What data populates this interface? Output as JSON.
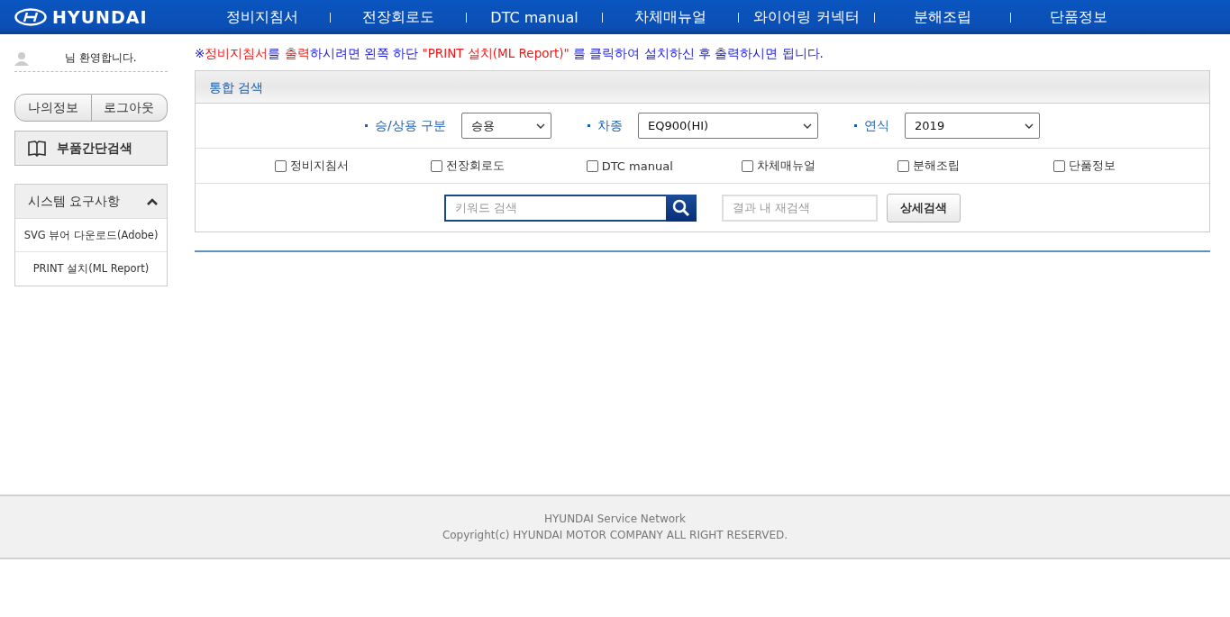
{
  "header": {
    "logo": "HYUNDAI",
    "nav": [
      "정비지침서",
      "전장회로도",
      "DTC manual",
      "차체매뉴얼",
      "와이어링 커넥터",
      "분해조립",
      "단품정보"
    ]
  },
  "sidebar": {
    "welcome": "님 환영합니다.",
    "buttons": [
      "나의정보",
      "로그아웃"
    ],
    "parts_search": "부품간단검색",
    "requirements": {
      "title": "시스템 요구사항",
      "expanded": true,
      "items": [
        "SVG 뷰어 다운로드(Adobe)",
        "PRINT 설치(ML Report)"
      ]
    }
  },
  "notice": [
    {
      "text": "※",
      "highlight": false
    },
    {
      "text": "정비지침서",
      "highlight": true
    },
    {
      "text": "를 ",
      "highlight": false
    },
    {
      "text": "출력",
      "highlight": true
    },
    {
      "text": "하시려면 왼쪽 하단 ",
      "highlight": false
    },
    {
      "text": "\"PRINT 설치(ML Report)\"",
      "highlight": true
    },
    {
      "text": " 를 클릭하여 설치하신 후 출력하시면 됩니다.",
      "highlight": false
    }
  ],
  "search_panel": {
    "title": "통합 검색",
    "filters": [
      {
        "label": "승/상용 구분",
        "value": "승용"
      },
      {
        "label": "차종",
        "value": "EQ900(HI)"
      },
      {
        "label": "연식",
        "value": "2019"
      }
    ],
    "checkboxes": [
      {
        "label": "정비지침서",
        "checked": false
      },
      {
        "label": "전장회로도",
        "checked": false
      },
      {
        "label": "DTC manual",
        "checked": false
      },
      {
        "label": "차체매뉴얼",
        "checked": false
      },
      {
        "label": "분해조립",
        "checked": false
      },
      {
        "label": "단품정보",
        "checked": false
      }
    ],
    "keyword_placeholder": "키워드 검색",
    "refine_placeholder": "결과 내 재검색",
    "detail_button": "상세검색"
  },
  "footer": {
    "lines": [
      "HYUNDAI Service Network",
      "Copyright(c) HYUNDAI MOTOR COMPANY ALL RIGHT RESERVED."
    ]
  }
}
